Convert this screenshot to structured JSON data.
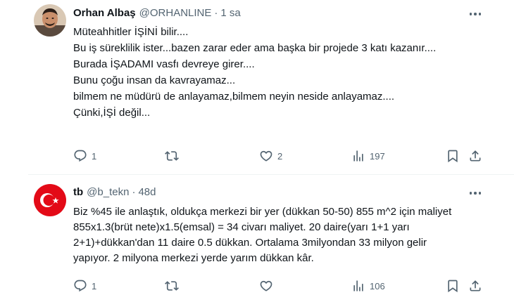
{
  "tweets": [
    {
      "name": "Orhan Albaş",
      "handle": "@ORHANLINE",
      "separator": "·",
      "time": "1 sa",
      "text_lines": [
        "Müteahhitler İŞİNİ bilir....",
        "Bu iş süreklilik ister...bazen zarar eder ama başka bir projede 3 katı kazanır....",
        "Burada İŞADAMI vasfı devreye girer....",
        "Bunu çoğu insan da kavrayamaz...",
        "bilmem ne müdürü de anlayamaz,bilmem neyin neside anlayamaz....",
        "Çünki,İŞİ değil..."
      ],
      "replies": "1",
      "retweets": "",
      "likes": "2",
      "views": "197"
    },
    {
      "name": "tb",
      "handle": "@b_tekn",
      "separator": "·",
      "time": "48d",
      "text_lines": [
        "Biz %45 ile anlaştık, oldukça merkezi bir yer (dükkan 50-50) 855 m^2 için maliyet 855x1.3(brüt nete)x1.5(emsal) = 34 civarı maliyet. 20 daire(yarı 1+1 yarı 2+1)+dükkan'dan 11 daire 0.5 dükkan. Ortalama 3milyondan  33 milyon gelir yapıyor. 2 milyona merkezi yerde yarım dükkan kâr."
      ],
      "replies": "1",
      "retweets": "",
      "likes": "",
      "views": "106"
    }
  ],
  "icons": {
    "reply": "reply-icon",
    "retweet": "retweet-icon",
    "like": "like-icon",
    "views": "views-icon",
    "bookmark": "bookmark-icon",
    "share": "share-icon",
    "more": "more-icon"
  },
  "colors": {
    "text": "#0f1419",
    "secondary": "#536471",
    "divider": "#eff3f4",
    "flag_red": "#e30a17"
  }
}
